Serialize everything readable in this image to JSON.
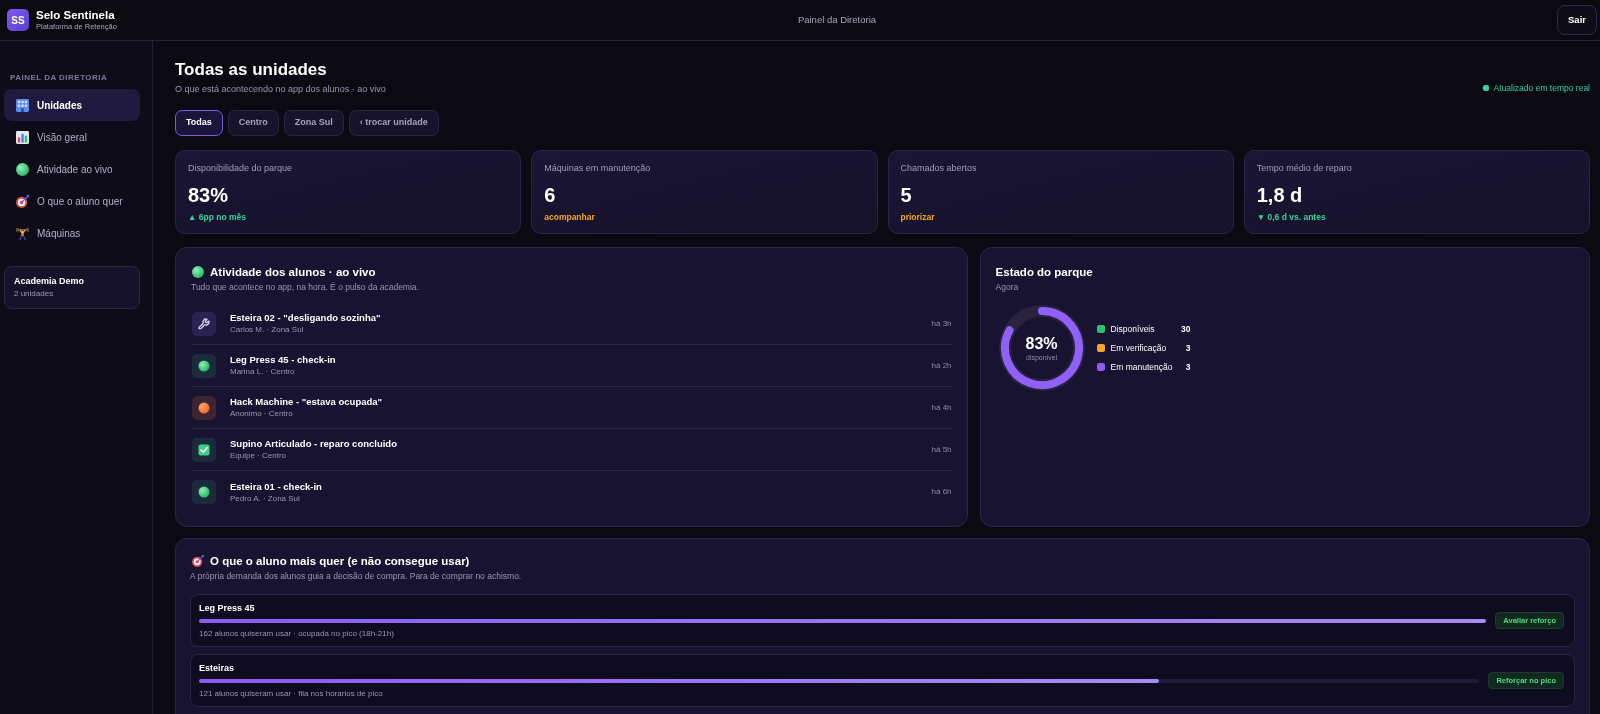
{
  "header": {
    "logo": "SS",
    "brand": "Selo Sentinela",
    "tagline": "Plataforma de Retenção",
    "title": "Painel da Diretoria",
    "logout": "Sair"
  },
  "sidebar": {
    "section": "PAINEL DA DIRETORIA",
    "items": [
      {
        "label": "Unidades",
        "selected": true
      },
      {
        "label": "Visão geral",
        "selected": false
      },
      {
        "label": "Atividade ao vivo",
        "selected": false
      },
      {
        "label": "O que o aluno quer",
        "selected": false
      },
      {
        "label": "Máquinas",
        "selected": false
      }
    ],
    "account": {
      "name": "Academia Demo",
      "detail": "2 unidades"
    }
  },
  "page": {
    "title": "Todas as unidades",
    "subtitle": "O que está acontecendo no app dos alunos · ao vivo",
    "live_status": "Atualizado em tempo real"
  },
  "filters": [
    {
      "label": "Todas",
      "selected": true
    },
    {
      "label": "Centro",
      "selected": false
    },
    {
      "label": "Zona Sul",
      "selected": false
    },
    {
      "label": "‹ trocar unidade",
      "selected": false
    }
  ],
  "stats": [
    {
      "label": "Disponibilidade do parque",
      "value": "83%",
      "note": "▲ 6pp no mês",
      "color": "#34d399"
    },
    {
      "label": "Máquinas em manutenção",
      "value": "6",
      "note": "acompanhar",
      "color": "#f5a524"
    },
    {
      "label": "Chamados abertos",
      "value": "5",
      "note": "priorizar",
      "color": "#f5a524"
    },
    {
      "label": "Tempo médio de reparo",
      "value": "1,8 d",
      "note": "▼ 0,6 d vs. antes",
      "color": "#34d399"
    }
  ],
  "activity": {
    "title": "Atividade dos alunos · ao vivo",
    "subtitle": "Tudo que acontece no app, na hora. É o pulso da academia.",
    "events": [
      {
        "kind": "issue",
        "title": "Esteira 02 - \"desligando sozinha\"",
        "detail": "Carlos M. · Zona Sul",
        "time": "há 3h"
      },
      {
        "kind": "checkin",
        "title": "Leg Press 45 - check-in",
        "detail": "Marina L. · Centro",
        "time": "há 2h"
      },
      {
        "kind": "busy",
        "title": "Hack Machine - \"estava ocupada\"",
        "detail": "Anonimo · Centro",
        "time": "há 4h"
      },
      {
        "kind": "fixed",
        "title": "Supino Articulado - reparo concluido",
        "detail": "Equipe · Centro",
        "time": "há 5h"
      },
      {
        "kind": "checkin",
        "title": "Esteira 01 - check-in",
        "detail": "Pedro A. · Zona Sul",
        "time": "há 6h"
      }
    ]
  },
  "fleet": {
    "title": "Estado do parque",
    "subtitle": "Agora",
    "level": 0.83,
    "value": "83%",
    "caption": "disponivel",
    "legend": [
      {
        "label": "Disponíveis",
        "value": "30",
        "color": "#2fbf71"
      },
      {
        "label": "Em verificação",
        "value": "3",
        "color": "#f5a524"
      },
      {
        "label": "Em manutenção",
        "value": "3",
        "color": "#8b5cf6"
      }
    ]
  },
  "demand": {
    "title": "O que o aluno mais quer (e não consegue usar)",
    "subtitle": "A própria demanda dos alunos guia a decisão de compra. Para de comprar no achismo.",
    "items": [
      {
        "name": "Leg Press 45",
        "level": 1.0,
        "note": "162 alunos quiseram usar · ocupada no pico (18h-21h)",
        "action": "Avaliar reforço"
      },
      {
        "name": "Esteiras",
        "level": 0.75,
        "note": "121 alunos quiseram usar · fila nos horarios de pico",
        "action": "Reforçar no pico"
      }
    ]
  }
}
